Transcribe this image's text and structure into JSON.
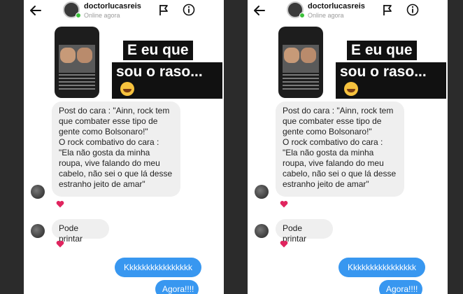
{
  "header": {
    "username": "doctorlucasreis",
    "status": "Online agora"
  },
  "story": {
    "overlay_line1": "E eu que",
    "overlay_line2": "sou o raso..."
  },
  "messages": {
    "post_lines": [
      "Post do cara : \"Ainn, rock tem",
      "que combater esse tipo de",
      "gente como Bolsonaro!\"",
      "O rock combativo do cara :",
      "\"Ela não gosta da minha",
      "roupa, vive falando do meu",
      "cabelo, não sei o que lá desse",
      "estranho jeito de amar\""
    ],
    "print_text": "Pode printar",
    "sent_1": "Kkkkkkkkkkkkkkkk",
    "sent_2": "Agora!!!!"
  },
  "colors": {
    "sent_bubble": "#3897f0",
    "received_bubble": "#efefef",
    "online": "#3cc13b",
    "heart": "#e0245e"
  },
  "icons": [
    "back-arrow-icon",
    "flag-icon",
    "info-icon",
    "heart-icon",
    "laughing-emoji-icon"
  ]
}
